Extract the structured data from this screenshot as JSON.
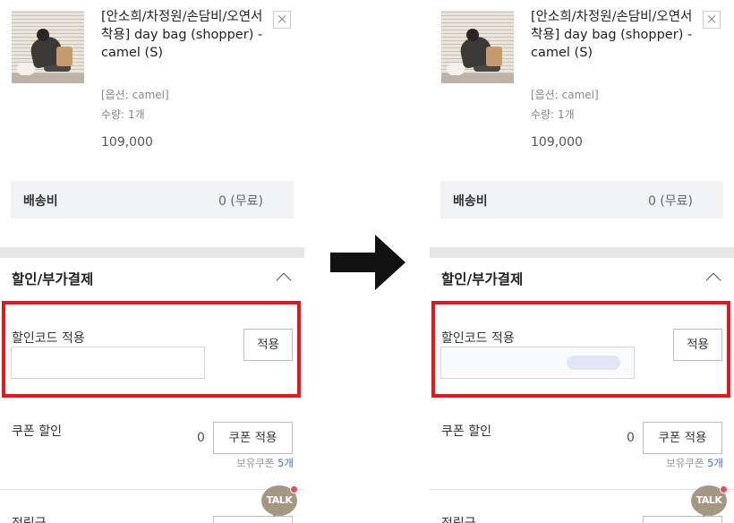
{
  "product": {
    "name": "[안소희/차정원/손담비/오연서 착용] day bag (shopper) - camel (S)",
    "option": "[옵션: camel]",
    "quantity": "수량: 1개",
    "price": "109,000",
    "close_glyph": "×"
  },
  "shipping": {
    "label": "배송비",
    "value": "0 (무료)"
  },
  "discount_section": {
    "title": "할인/부가결제",
    "code_label": "할인코드 적용",
    "code_apply_label": "적용",
    "coupon_label": "쿠폰 할인",
    "coupon_value": "0",
    "coupon_apply_label": "쿠폰 적용",
    "owned_coupons_prefix": "보유쿠폰",
    "owned_coupons_count": "5개",
    "points_label": "적립금"
  },
  "talk_badge": "TALK",
  "colors": {
    "highlight": "#e3171e",
    "accent_link": "#3c6be6",
    "talk": "#a59883"
  },
  "icons": [
    "close-icon",
    "chevron-up-icon",
    "talk-icon",
    "arrow-right-icon"
  ]
}
